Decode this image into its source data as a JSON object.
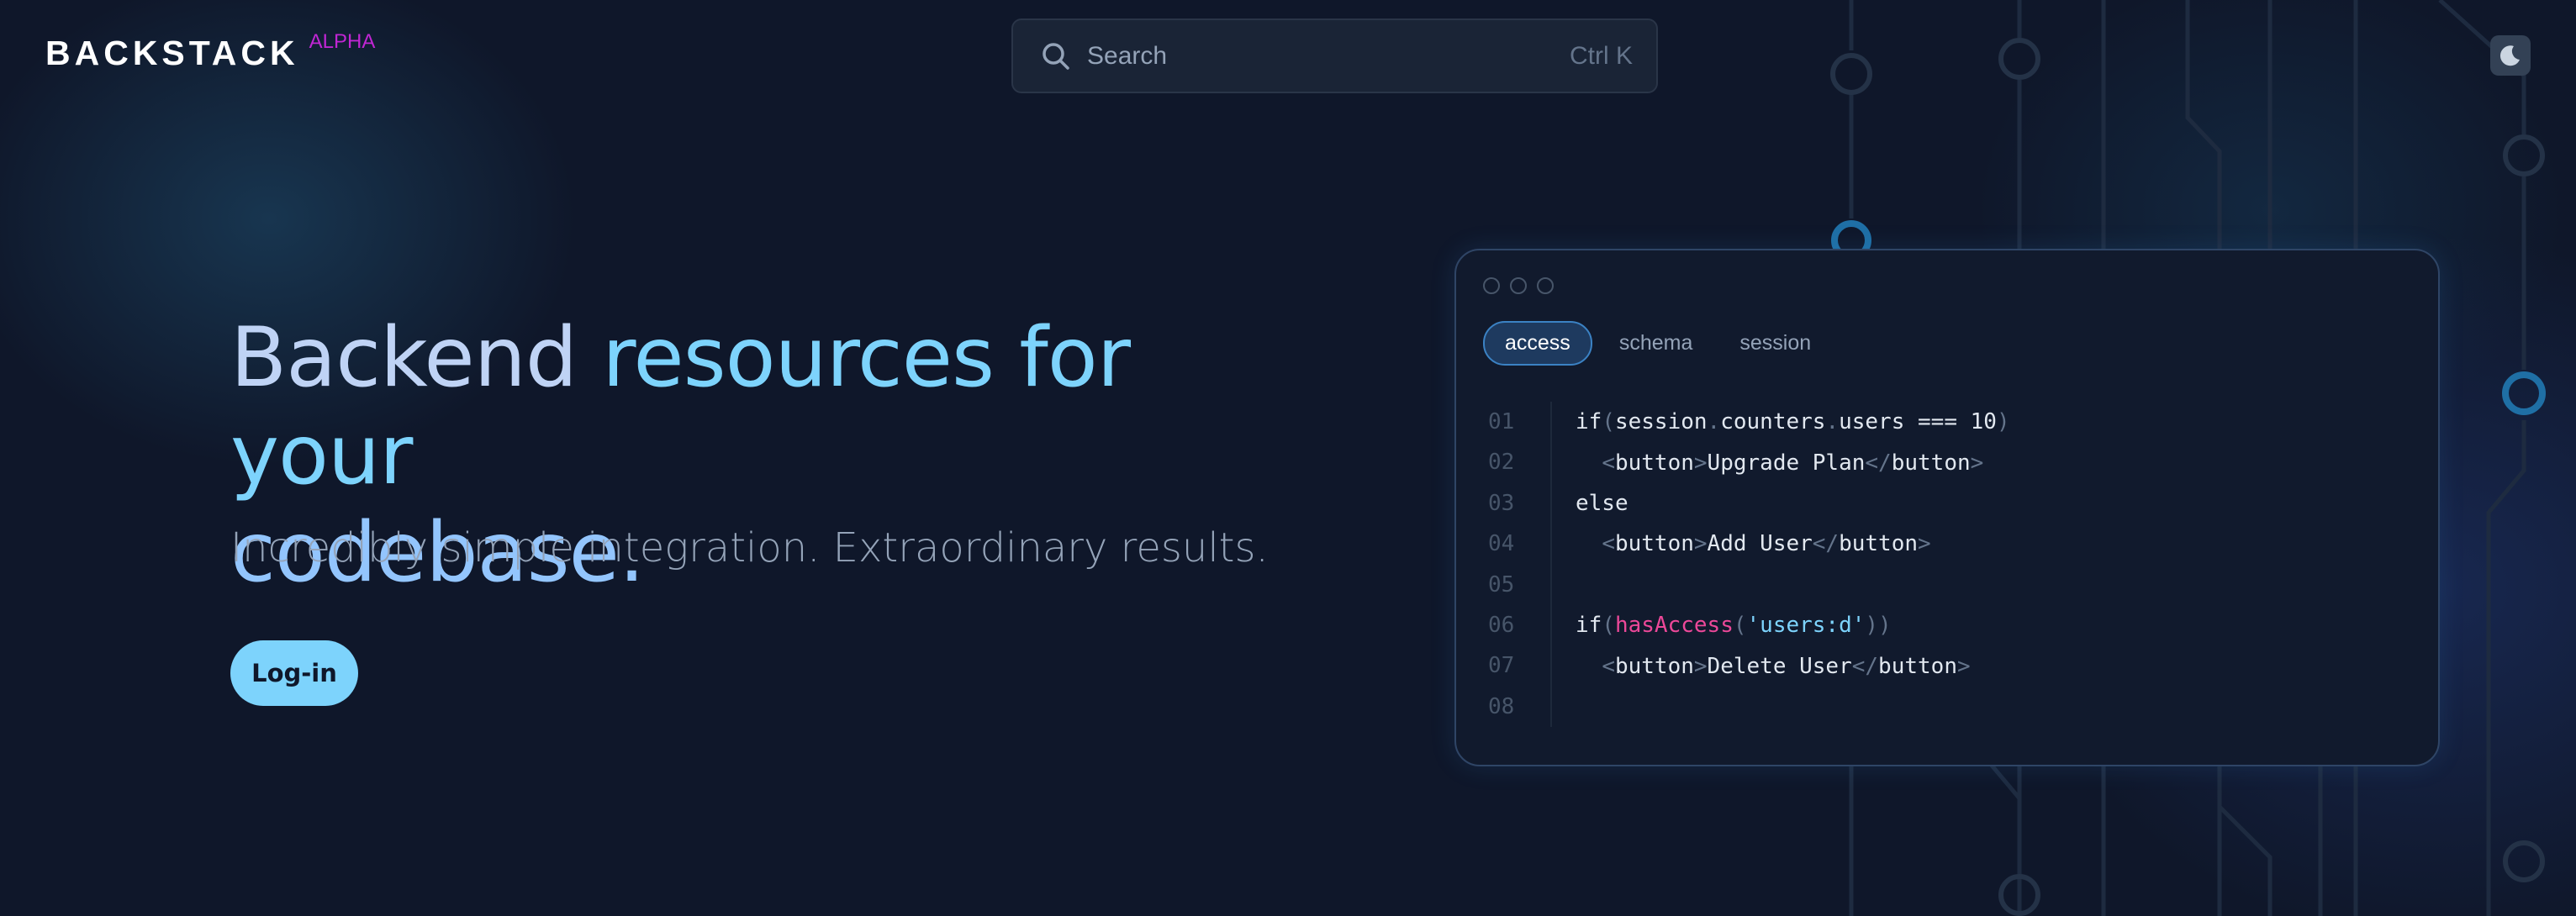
{
  "header": {
    "logo": "BACKSTACK",
    "badge": "ALPHA",
    "search_placeholder": "Search",
    "search_shortcut": "Ctrl K"
  },
  "hero": {
    "title_part1": "Backend ",
    "title_part2": "resources for your",
    "title_part3": "codebase.",
    "subtitle": "Incredibly simple integration. Extraordinary results.",
    "login_label": "Log-in"
  },
  "code_window": {
    "tabs": [
      "access",
      "schema",
      "session"
    ],
    "active_tab": "access",
    "line_numbers": [
      "01",
      "02",
      "03",
      "04",
      "05",
      "06",
      "07",
      "08"
    ]
  },
  "colors": {
    "background": "#0f172a",
    "accent": "#7dd3fc",
    "badge": "#c026d3",
    "keyword_fn": "#ec4899"
  }
}
